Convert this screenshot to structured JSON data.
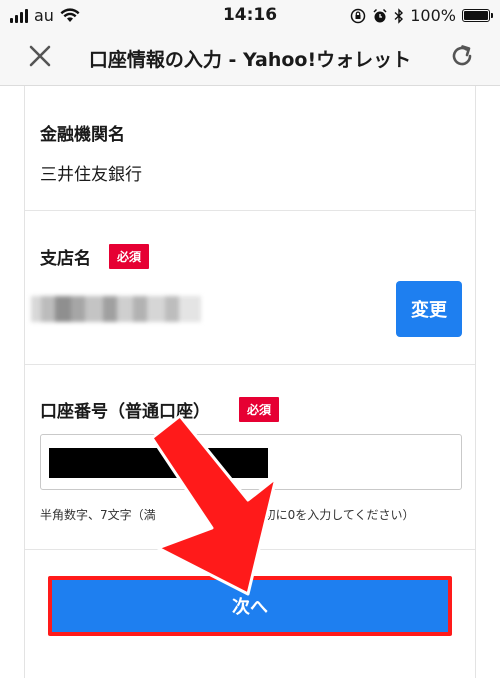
{
  "status_bar": {
    "carrier": "au",
    "time": "14:16",
    "battery_text": "100%",
    "battery_level": 1.0,
    "icons": [
      "signal-icon",
      "wifi-icon",
      "lock-rotation-icon",
      "alarm-icon",
      "bluetooth-icon",
      "battery-icon"
    ]
  },
  "header": {
    "title": "口座情報の入力 - Yahoo!ウォレット",
    "close_icon": "close-icon",
    "reload_icon": "reload-icon"
  },
  "form": {
    "bank": {
      "label": "金融機関名",
      "value": "三井住友銀行"
    },
    "branch": {
      "label": "支店名",
      "required_badge": "必須",
      "change_button": "変更"
    },
    "account": {
      "label": "口座番号（普通口座）",
      "required_badge": "必須",
      "hint": "半角数字、7文字（満　　　　　　　は最初に0を入力してください）"
    },
    "next_button": "次へ"
  },
  "colors": {
    "accent_blue": "#1e7ff0",
    "badge_red": "#e60033",
    "highlight_red": "#ff1a1a"
  }
}
